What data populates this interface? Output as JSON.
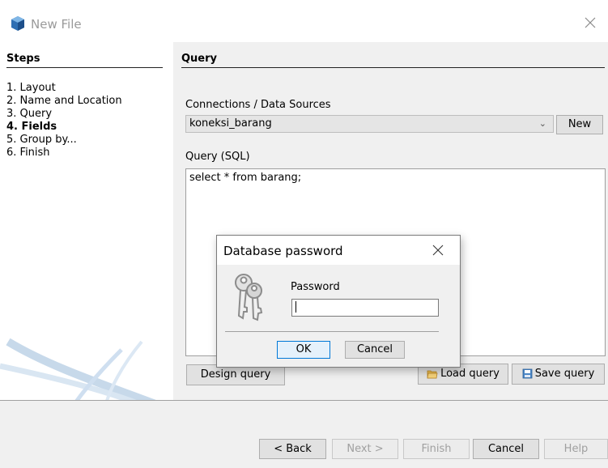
{
  "window": {
    "title": "New File",
    "icon": "netbeans-cube-icon"
  },
  "steps": {
    "header": "Steps",
    "items": [
      {
        "label": "1.  Layout"
      },
      {
        "label": "2.  Name and Location"
      },
      {
        "label": "3.  Query"
      },
      {
        "label": "4.  Fields"
      },
      {
        "label": "5.  Group by..."
      },
      {
        "label": "6.  Finish"
      }
    ],
    "current_index": 3
  },
  "query_panel": {
    "header": "Query",
    "connections_label": "Connections / Data Sources",
    "connection_selected": "koneksi_barang",
    "new_button": "New",
    "sql_label": "Query (SQL)",
    "sql_text": "select * from barang;",
    "design_query_button": "Design query",
    "load_query_button": "Load query",
    "save_query_button": "Save query"
  },
  "navigation": {
    "back": "< Back",
    "next": "Next >",
    "finish": "Finish",
    "cancel": "Cancel",
    "help": "Help"
  },
  "password_dialog": {
    "title": "Database password",
    "field_label": "Password",
    "field_value": "",
    "ok": "OK",
    "cancel": "Cancel"
  },
  "colors": {
    "panel_bg": "#f0f0f0",
    "button_bg": "#e1e1e1",
    "default_button_border": "#0078d7",
    "disabled_text": "#a0a0a0"
  }
}
